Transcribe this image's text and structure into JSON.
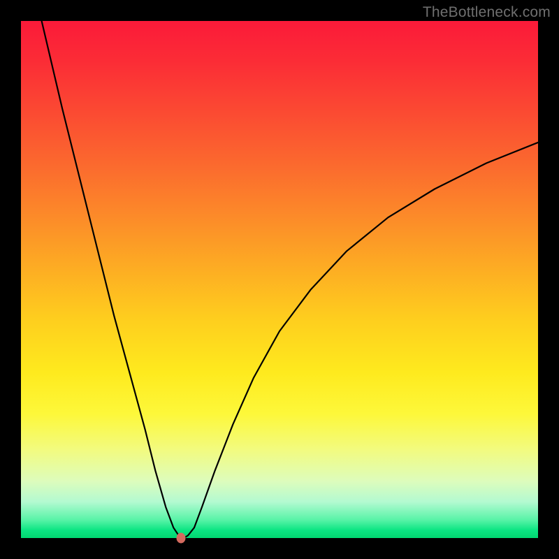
{
  "watermark": "TheBottleneck.com",
  "colors": {
    "frame": "#000000",
    "curve": "#000000",
    "marker": "#d46a5f",
    "watermark_text": "#6f6f6f"
  },
  "chart_data": {
    "type": "line",
    "title": "",
    "xlabel": "",
    "ylabel": "",
    "xlim": [
      0,
      100
    ],
    "ylim": [
      0,
      100
    ],
    "x": [
      4,
      8,
      12,
      15,
      18,
      21,
      24,
      26,
      28,
      29.5,
      30.5,
      31,
      31.5,
      32.3,
      33.5,
      35,
      37.5,
      41,
      45,
      50,
      56,
      63,
      71,
      80,
      90,
      100
    ],
    "values": [
      100,
      83,
      67,
      55,
      43,
      32,
      21,
      13,
      6,
      2,
      0.5,
      0,
      0,
      0.5,
      2,
      6,
      13,
      22,
      31,
      40,
      48,
      55.5,
      62,
      67.5,
      72.5,
      76.5
    ],
    "marker": {
      "x": 31,
      "y": 0
    }
  }
}
